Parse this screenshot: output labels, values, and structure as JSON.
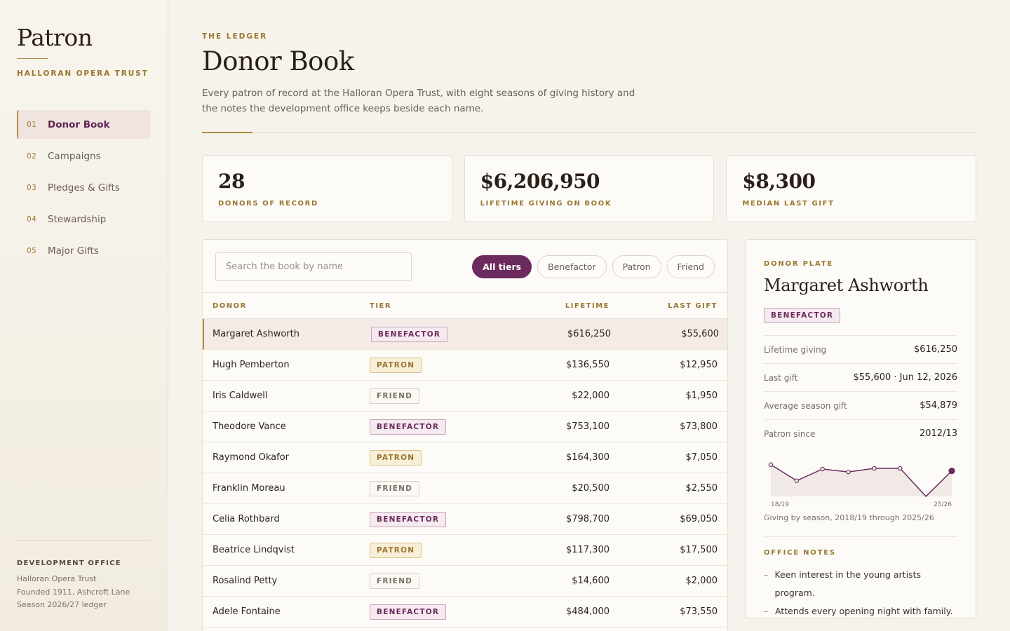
{
  "brand": {
    "name": "Patron",
    "subtitle": "HALLORAN OPERA TRUST"
  },
  "nav": [
    {
      "num": "01",
      "label": "Donor Book",
      "active": true
    },
    {
      "num": "02",
      "label": "Campaigns"
    },
    {
      "num": "03",
      "label": "Pledges & Gifts"
    },
    {
      "num": "04",
      "label": "Stewardship"
    },
    {
      "num": "05",
      "label": "Major Gifts"
    }
  ],
  "footer": {
    "title": "DEVELOPMENT OFFICE",
    "lines": [
      "Halloran Opera Trust",
      "Founded 1911, Ashcroft Lane",
      "Season 2026/27 ledger"
    ]
  },
  "header": {
    "eyebrow": "THE LEDGER",
    "title": "Donor Book",
    "description": "Every patron of record at the Halloran Opera Trust, with eight seasons of giving history and the notes the development office keeps beside each name."
  },
  "stats": [
    {
      "value": "28",
      "label": "DONORS OF RECORD"
    },
    {
      "value": "$6,206,950",
      "label": "LIFETIME GIVING ON BOOK"
    },
    {
      "value": "$8,300",
      "label": "MEDIAN LAST GIFT"
    }
  ],
  "search": {
    "placeholder": "Search the book by name",
    "value": ""
  },
  "filters": [
    {
      "label": "All tiers",
      "active": true
    },
    {
      "label": "Benefactor"
    },
    {
      "label": "Patron"
    },
    {
      "label": "Friend"
    }
  ],
  "table": {
    "columns": [
      "DONOR",
      "TIER",
      "LIFETIME",
      "LAST GIFT"
    ],
    "rows": [
      {
        "name": "Margaret Ashworth",
        "tier": "BENEFACTOR",
        "lifetime": "$616,250",
        "last": "$55,600",
        "selected": true
      },
      {
        "name": "Hugh Pemberton",
        "tier": "PATRON",
        "lifetime": "$136,550",
        "last": "$12,950"
      },
      {
        "name": "Iris Caldwell",
        "tier": "FRIEND",
        "lifetime": "$22,000",
        "last": "$1,950"
      },
      {
        "name": "Theodore Vance",
        "tier": "BENEFACTOR",
        "lifetime": "$753,100",
        "last": "$73,800"
      },
      {
        "name": "Raymond Okafor",
        "tier": "PATRON",
        "lifetime": "$164,300",
        "last": "$7,050"
      },
      {
        "name": "Franklin Moreau",
        "tier": "FRIEND",
        "lifetime": "$20,500",
        "last": "$2,550"
      },
      {
        "name": "Celia Rothbard",
        "tier": "BENEFACTOR",
        "lifetime": "$798,700",
        "last": "$69,050"
      },
      {
        "name": "Beatrice Lindqvist",
        "tier": "PATRON",
        "lifetime": "$117,300",
        "last": "$17,500"
      },
      {
        "name": "Rosalind Petty",
        "tier": "FRIEND",
        "lifetime": "$14,600",
        "last": "$2,000"
      },
      {
        "name": "Adele Fontaine",
        "tier": "BENEFACTOR",
        "lifetime": "$484,000",
        "last": "$73,550"
      }
    ]
  },
  "plate": {
    "eyebrow": "DONOR PLATE",
    "name": "Margaret Ashworth",
    "tier": "BENEFACTOR",
    "facts": [
      {
        "label": "Lifetime giving",
        "value": "$616,250"
      },
      {
        "label": "Last gift",
        "value": "$55,600 · Jun 12, 2026"
      },
      {
        "label": "Average season gift",
        "value": "$54,879"
      },
      {
        "label": "Patron since",
        "value": "2012/13"
      }
    ],
    "spark": {
      "start_label": "18/19",
      "end_label": "25/26",
      "caption": "Giving by season, 2018/19 through 2025/26",
      "values": [
        0.82,
        0.38,
        0.7,
        0.62,
        0.72,
        0.72,
        -0.05,
        0.65
      ]
    },
    "notes_title": "OFFICE NOTES",
    "notes": [
      "Keen interest in the young artists program.",
      "Attends every opening night with family."
    ]
  },
  "colors": {
    "accent": "#6b2b5e",
    "gold": "#b08b45",
    "background": "#f6f3ec"
  }
}
